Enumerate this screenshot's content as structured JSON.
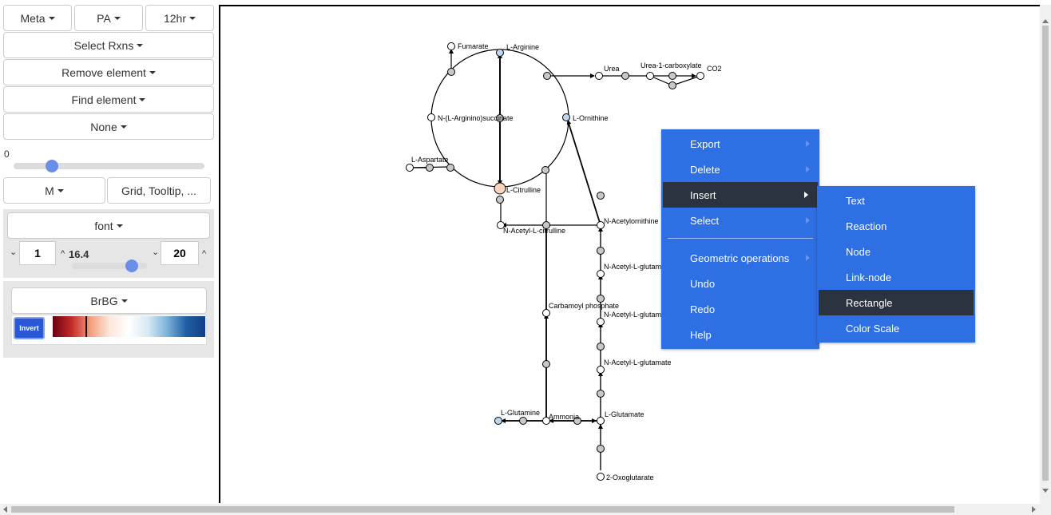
{
  "toolbar": {
    "meta_label": "Meta",
    "pa_label": "PA",
    "time_label": "12hr",
    "select_rxns_label": "Select Rxns",
    "remove_element_label": "Remove element",
    "find_element_label": "Find element",
    "none_label": "None"
  },
  "time_slider": {
    "value_label": "0",
    "level": 0.2
  },
  "mode": {
    "m_label": "M",
    "grid_label": "Grid, Tooltip, ..."
  },
  "font_panel": {
    "font_label": "font",
    "min_value": "1",
    "size_value": "16.4",
    "max_value": "20",
    "size_level": 0.8
  },
  "color_panel": {
    "scale_label": "BrBG",
    "invert_label": "Invert",
    "gradient_colors": [
      "#6b0010",
      "#c52b2b",
      "#f4a07e",
      "#fde7dc",
      "#ffffff",
      "#d6e9f4",
      "#7db2d8",
      "#1f5fa6",
      "#123f86"
    ]
  },
  "network": {
    "nodes": [
      {
        "id": "fumarate",
        "label": "Fumarate"
      },
      {
        "id": "l_arginine",
        "label": "L-Arginine"
      },
      {
        "id": "urea",
        "label": "Urea"
      },
      {
        "id": "urea1c",
        "label": "Urea-1-carboxylate"
      },
      {
        "id": "co2",
        "label": "CO2"
      },
      {
        "id": "argsucc",
        "label": "N-(L-Arginino)succinate"
      },
      {
        "id": "l_ornithine",
        "label": "L-Ornithine"
      },
      {
        "id": "l_aspartate",
        "label": "L-Aspartate"
      },
      {
        "id": "l_citrulline",
        "label": "L-Citrulline"
      },
      {
        "id": "n_acetylornithine",
        "label": "N-Acetylornithine"
      },
      {
        "id": "n_acetyl_citrulline",
        "label": "N-Acetyl-L-citrulline"
      },
      {
        "id": "n_acetyl_glu1",
        "label": "N-Acetyl-L-glutam"
      },
      {
        "id": "carbamoyl",
        "label": "Carbamoyl phosphate"
      },
      {
        "id": "n_acetyl_glu2",
        "label": "N-Acetyl-L-glutam"
      },
      {
        "id": "n_acetyl_glutamate",
        "label": "N-Acetyl-L-glutamate"
      },
      {
        "id": "l_glutamine",
        "label": "L-Glutamine"
      },
      {
        "id": "ammonia",
        "label": "Ammonia"
      },
      {
        "id": "l_glutamate",
        "label": "L-Glutamate"
      },
      {
        "id": "oxoglutarate",
        "label": "2-Oxoglutarate"
      }
    ]
  },
  "context_menu": {
    "items": [
      "Export",
      "Delete",
      "Insert",
      "Select",
      "Geometric operations",
      "Undo",
      "Redo",
      "Help"
    ],
    "active_item": "Insert"
  },
  "insert_submenu": {
    "items": [
      "Text",
      "Reaction",
      "Node",
      "Link-node",
      "Rectangle",
      "Color Scale"
    ],
    "active_item": "Rectangle"
  },
  "colors": {
    "menu_blue": "#2f6fe4",
    "menu_selected": "#2c3340",
    "node_gray": "#c8c8c8",
    "node_light_blue": "#bcd7ee",
    "node_peach": "#fbd3bf",
    "invert_button": "#2a57d6"
  },
  "scroll": {
    "horizontal_position": 0.0,
    "vertical_position": 0.0
  }
}
